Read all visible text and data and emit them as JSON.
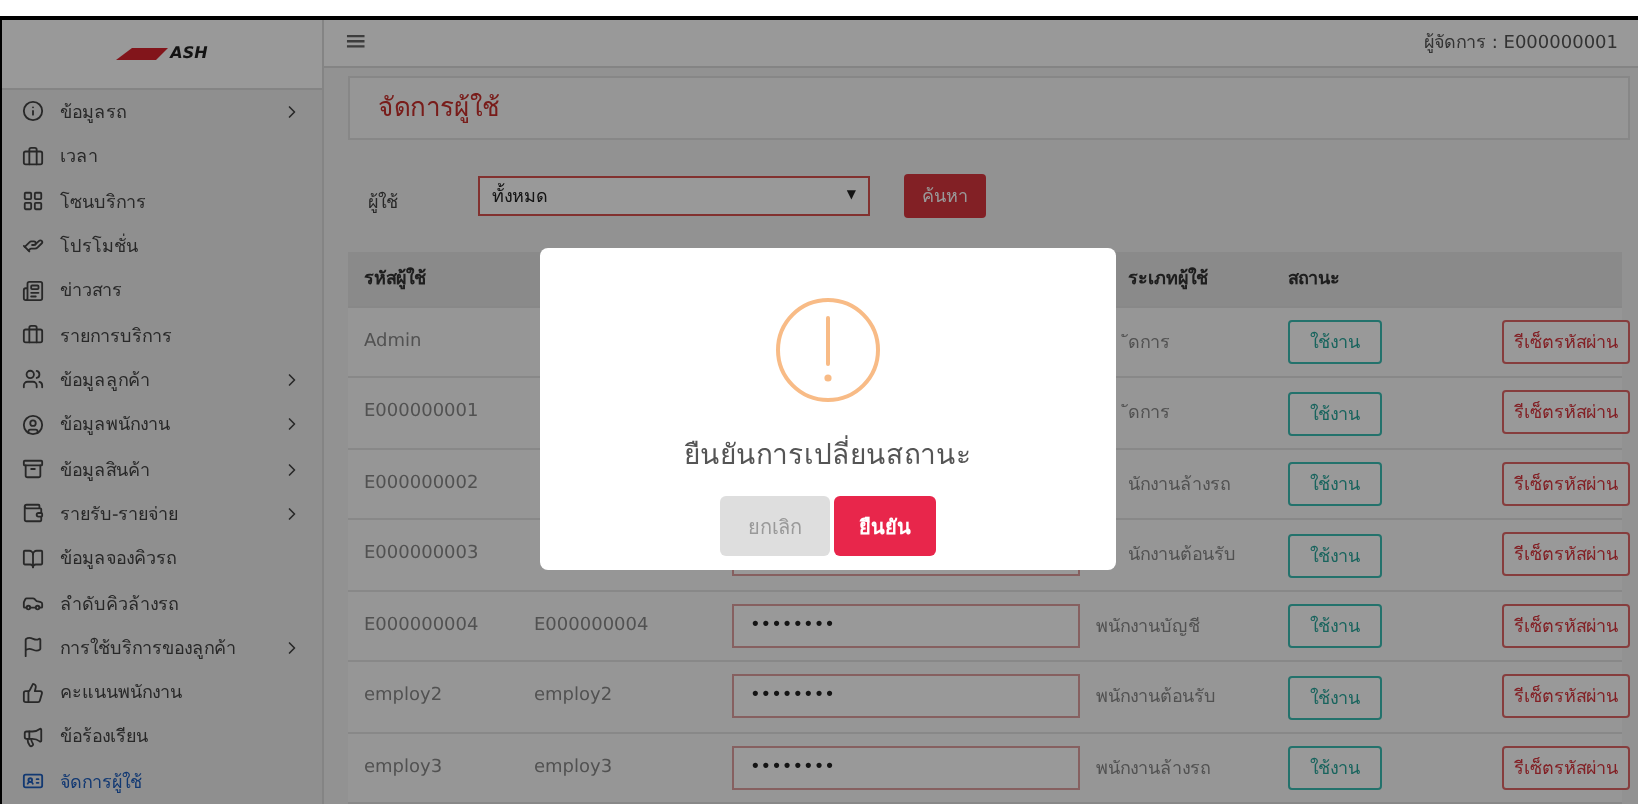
{
  "logo": {
    "text": "ASH"
  },
  "sidebar": {
    "items": [
      {
        "label": "ข้อมูลรถ",
        "has_submenu": true,
        "selected": false
      },
      {
        "label": "เวลา",
        "has_submenu": false,
        "selected": false
      },
      {
        "label": "โซนบริการ",
        "has_submenu": false,
        "selected": false
      },
      {
        "label": "โปรโมชั่น",
        "has_submenu": false,
        "selected": false
      },
      {
        "label": "ข่าวสาร",
        "has_submenu": false,
        "selected": false
      },
      {
        "label": "รายการบริการ",
        "has_submenu": false,
        "selected": false
      },
      {
        "label": "ข้อมูลลูกค้า",
        "has_submenu": true,
        "selected": false
      },
      {
        "label": "ข้อมูลพนักงาน",
        "has_submenu": true,
        "selected": false
      },
      {
        "label": "ข้อมูลสินค้า",
        "has_submenu": true,
        "selected": false
      },
      {
        "label": "รายรับ-รายจ่าย",
        "has_submenu": true,
        "selected": false
      },
      {
        "label": "ข้อมูลจองคิวรถ",
        "has_submenu": false,
        "selected": false
      },
      {
        "label": "ลำดับคิวล้างรถ",
        "has_submenu": false,
        "selected": false
      },
      {
        "label": "การใช้บริการของลูกค้า",
        "has_submenu": true,
        "selected": false
      },
      {
        "label": "คะแนนพนักงาน",
        "has_submenu": false,
        "selected": false
      },
      {
        "label": "ข้อร้องเรียน",
        "has_submenu": false,
        "selected": false
      },
      {
        "label": "จัดการผู้ใช้",
        "has_submenu": false,
        "selected": true
      }
    ]
  },
  "header": {
    "menu_glyph": "≡",
    "user": "ผู้จัดการ : E000000001"
  },
  "page_title": "จัดการผู้ใช้",
  "filter": {
    "label": "ผู้ใช้",
    "value": "ทั้งหมด",
    "arrow": "▼",
    "button": "ค้นหา"
  },
  "table": {
    "columns": [
      "รหัสผู้ใช้",
      "",
      "",
      "ระเภทผู้ใช้",
      "สถานะ",
      ""
    ],
    "rows": [
      {
        "code": "Admin",
        "password": "",
        "type": "ัดการ",
        "status": "ใช้งาน",
        "reset": "รีเซ็ตรหัสผ่าน"
      },
      {
        "code": "E000000001",
        "password": "",
        "type": "ัดการ",
        "status": "ใช้งาน",
        "reset": "รีเซ็ตรหัสผ่าน"
      },
      {
        "code": "E000000002",
        "password": "",
        "type": "นักงานล้างรถ",
        "status": "ใช้งาน",
        "reset": "รีเซ็ตรหัสผ่าน"
      },
      {
        "code": "E000000003",
        "password": "",
        "type": "นักงานต้อนรับ",
        "status": "ใช้งาน",
        "reset": "รีเซ็ตรหัสผ่าน"
      },
      {
        "code": "E000000004",
        "name": "E000000004",
        "password": "••••••••",
        "type": "พนักงานบัญชี",
        "status": "ใช้งาน",
        "reset": "รีเซ็ตรหัสผ่าน"
      },
      {
        "code": "employ2",
        "name": "employ2",
        "password": "••••••••",
        "type": "พนักงานต้อนรับ",
        "status": "ใช้งาน",
        "reset": "รีเซ็ตรหัสผ่าน"
      },
      {
        "code": "employ3",
        "name": "employ3",
        "password": "••••••••",
        "type": "พนักงานล้างรถ",
        "status": "ใช้งาน",
        "reset": "รีเซ็ตรหัสผ่าน"
      }
    ]
  },
  "dialog": {
    "title": "ยืนยันการเปลี่ยนสถานะ",
    "cancel": "ยกเลิก",
    "confirm": "ยืนยัน"
  }
}
